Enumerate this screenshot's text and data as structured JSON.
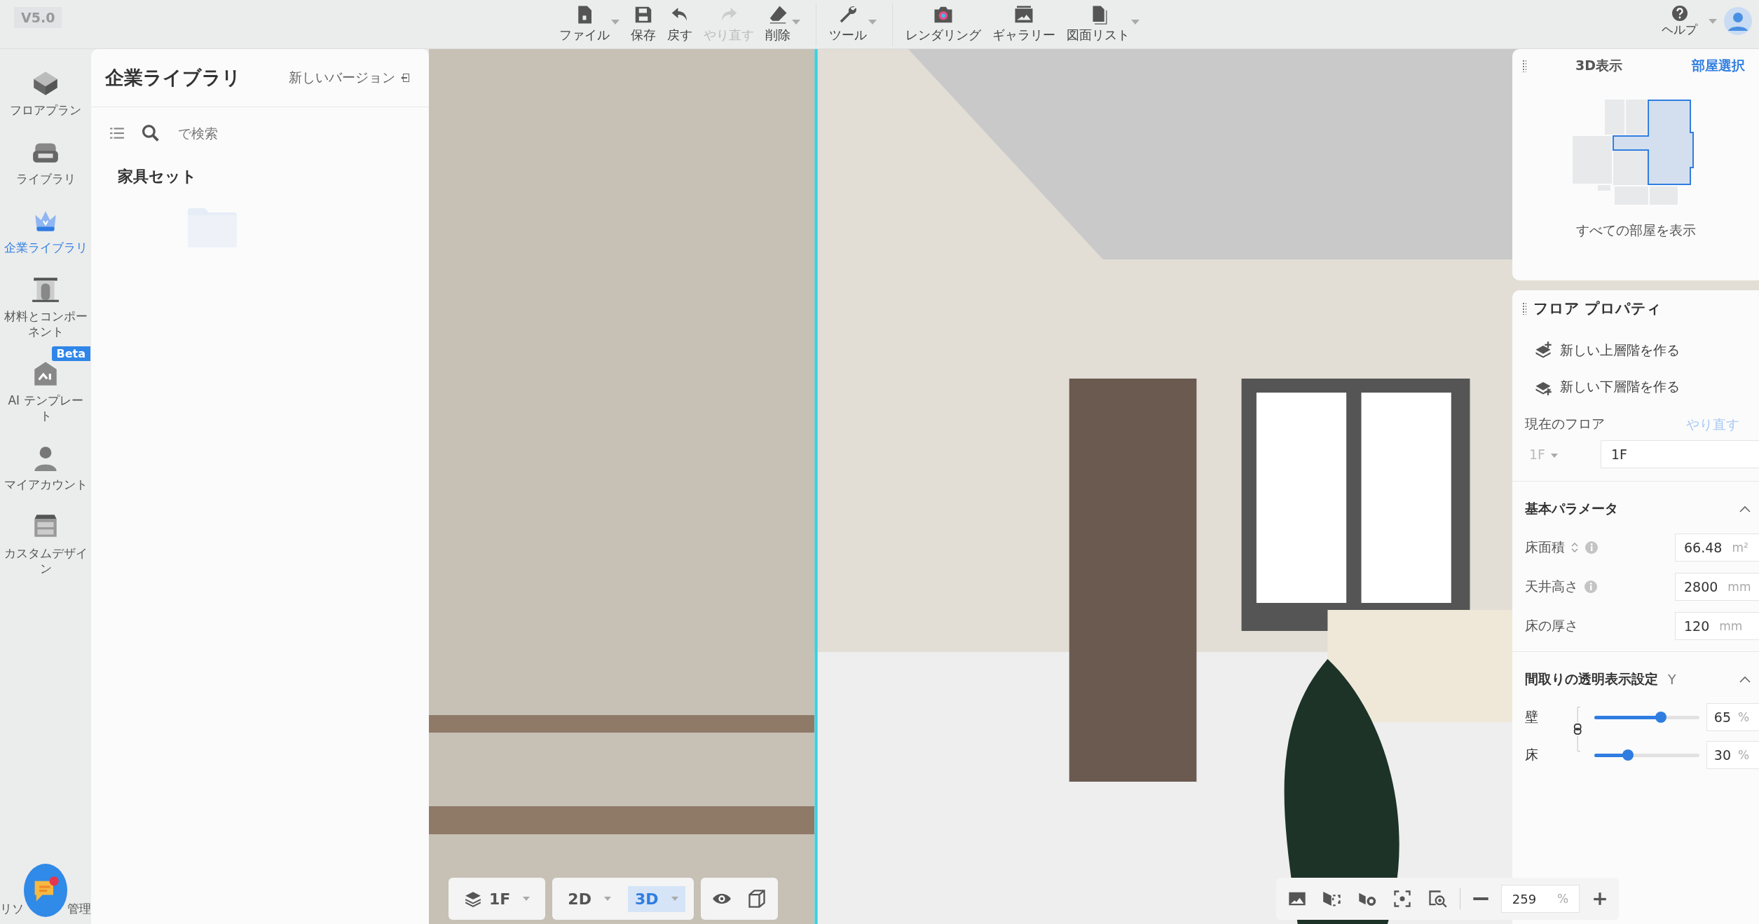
{
  "version": "V5.0",
  "toolbar": [
    {
      "label": "ファイル",
      "dropdown": true,
      "disabled": false
    },
    {
      "label": "保存",
      "dropdown": false,
      "disabled": false
    },
    {
      "label": "戻す",
      "dropdown": false,
      "disabled": false
    },
    {
      "label": "やり直す",
      "dropdown": false,
      "disabled": true
    },
    {
      "label": "削除",
      "dropdown": true,
      "disabled": false
    },
    {
      "label": "ツール",
      "dropdown": true,
      "disabled": false
    },
    {
      "label": "レンダリング",
      "dropdown": false,
      "disabled": false
    },
    {
      "label": "ギャラリー",
      "dropdown": false,
      "disabled": false
    },
    {
      "label": "図面リスト",
      "dropdown": true,
      "disabled": false
    }
  ],
  "help": {
    "label": "ヘルプ"
  },
  "sidebar": {
    "items": [
      {
        "label": "フロアプラン",
        "selected": false
      },
      {
        "label": "ライブラリ",
        "selected": false
      },
      {
        "label": "企業ライブラリ",
        "selected": true
      },
      {
        "label": "材料とコンポーネント",
        "selected": false
      },
      {
        "label": "AI テンプレート",
        "selected": false,
        "badge": "Beta"
      },
      {
        "label": "マイアカウント",
        "selected": false
      },
      {
        "label": "カスタムデザイン",
        "selected": false
      }
    ],
    "footer_left": "リソ",
    "footer_right": "管理"
  },
  "library": {
    "title": "企業ライブラリ",
    "new_version": "新しいバージョン",
    "search": {
      "placeholder": "で検索"
    },
    "section": "家具セット"
  },
  "view_panel": {
    "title": "3D表示",
    "link": "部屋選択",
    "show_all": "すべての部屋を表示"
  },
  "floor_props": {
    "title": "フロア プロパティ",
    "actions": [
      {
        "label": "新しい上層階を作る"
      },
      {
        "label": "新しい下層階を作る"
      }
    ],
    "current_floor": "現在のフロア",
    "redo": "やり直す",
    "floor_select": "1F",
    "floor_name": "1F",
    "basic": {
      "title": "基本パラメータ",
      "rows": [
        {
          "label": "床面積",
          "sort": true,
          "info": true,
          "value": "66.48",
          "unit": "m²"
        },
        {
          "label": "天井高さ",
          "sort": false,
          "info": true,
          "value": "2800",
          "unit": "mm"
        },
        {
          "label": "床の厚さ",
          "sort": false,
          "info": false,
          "value": "120",
          "unit": "mm"
        }
      ]
    },
    "transparency": {
      "title": "間取りの透明表示設定",
      "shortcut": "Y",
      "sliders": [
        {
          "label": "壁",
          "level": 0.65,
          "value": "65",
          "unit": "%"
        },
        {
          "label": "床",
          "level": 0.3,
          "value": "30",
          "unit": "%"
        }
      ]
    }
  },
  "bottom_bar": {
    "floor": "1F",
    "modes": [
      {
        "label": "2D",
        "selected": false
      },
      {
        "label": "3D",
        "selected": true
      }
    ],
    "zoom": "259",
    "zoom_unit": "%"
  }
}
